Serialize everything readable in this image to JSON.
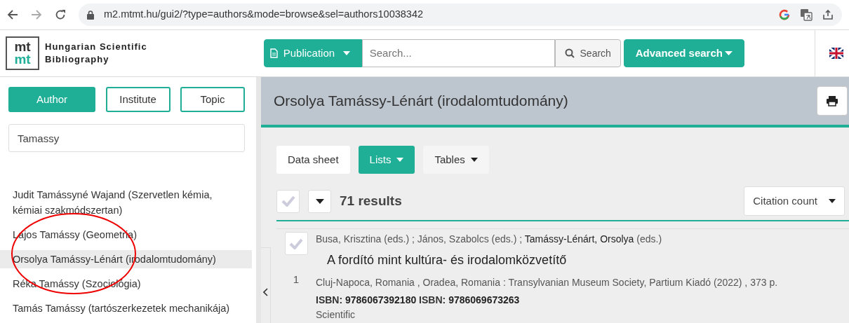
{
  "browser": {
    "url": "m2.mtmt.hu/gui2/?type=authors&mode=browse&sel=authors10038342"
  },
  "header": {
    "logo": [
      "mt",
      "mt"
    ],
    "site_name": [
      "Hungarian Scientific",
      "Bibliography"
    ],
    "type_button": "Publication",
    "search_placeholder": "Search...",
    "search_button": "Search",
    "advanced_button": "Advanced search"
  },
  "sidebar": {
    "tabs": [
      {
        "label": "Author",
        "selected": true
      },
      {
        "label": "Institute",
        "selected": false
      },
      {
        "label": "Topic",
        "selected": false
      }
    ],
    "search_value": "Tamassy",
    "results": [
      {
        "label": "Judit Tamássyné Wajand (Szervetlen kémia, kémiai szakmódszertan)",
        "selected": false
      },
      {
        "label": "Lajos Tamássy (Geometria)",
        "selected": false
      },
      {
        "label": "Orsolya Tamássy-Lénárt (irodalomtudomány)",
        "selected": true
      },
      {
        "label": "Réka Tamássy (Szociológia)",
        "selected": false
      },
      {
        "label": "Tamás Tamássy (tartószerkezetek mechanikája)",
        "selected": false
      }
    ]
  },
  "main": {
    "title": "Orsolya Tamássy-Lénárt (irodalomtudomány)",
    "view_tabs": [
      {
        "label": "Data sheet",
        "selected": false,
        "has_menu": false
      },
      {
        "label": "Lists",
        "selected": true,
        "has_menu": true
      },
      {
        "label": "Tables",
        "selected": false,
        "has_menu": true
      }
    ],
    "select_all_checked": false,
    "results_count": "71 results",
    "sort": "Citation count",
    "items": [
      {
        "checked": false,
        "number": "1",
        "authors": "Busa, Krisztina (eds.) ; János, Szabolcs (eds.) ; **Tamássy-Lénárt, Orsolya** (eds.)",
        "title": "A fordító mint kultúra- és irodalomközvetítő",
        "publisher": "Cluj-Napoca, Romania , Oradea, Romania : Transylvanian Museum Society, Partium Kiadó (2022) , 373 p.",
        "isbn": "ISBN: **9786067392180** ISBN: **9786069673263**",
        "type": "Scientific"
      }
    ]
  }
}
